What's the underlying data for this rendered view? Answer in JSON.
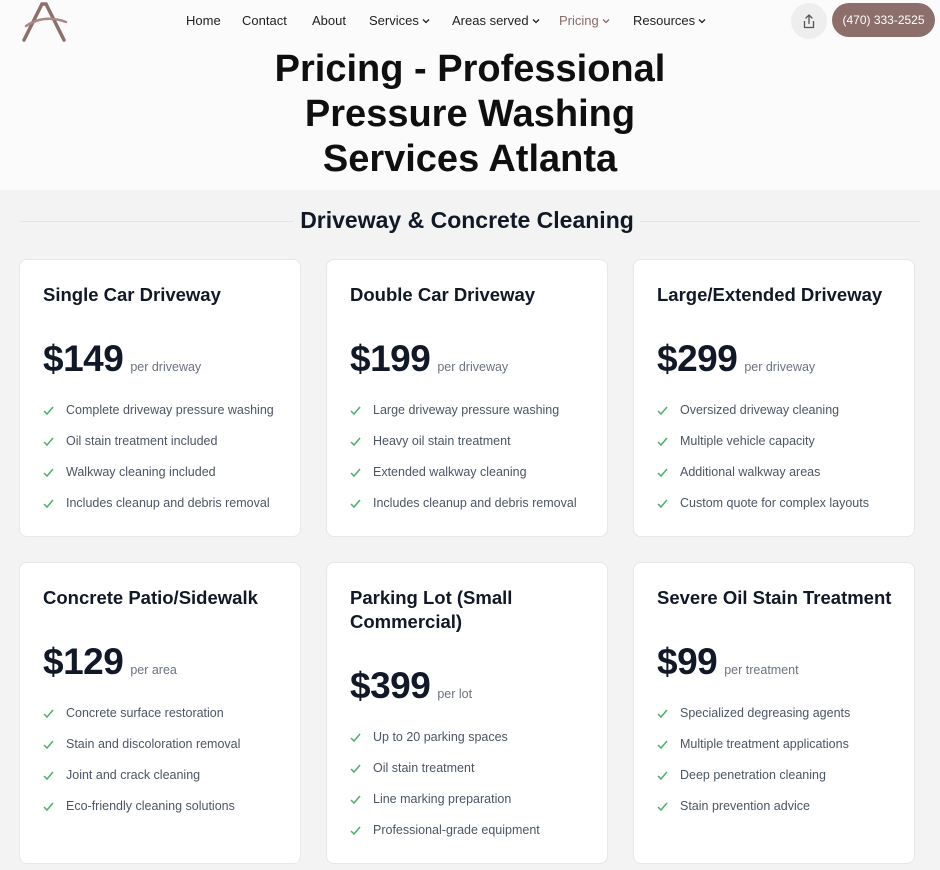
{
  "nav": {
    "items": [
      "Home",
      "Contact",
      "About",
      "Services",
      "Areas served",
      "Pricing",
      "Resources"
    ],
    "active": "Pricing",
    "dropdown_items": [
      "Services",
      "Areas served",
      "Pricing",
      "Resources"
    ],
    "phone": "(470) 333-2525",
    "brand_color": "#8c6e6a"
  },
  "hero": {
    "title_lines": [
      "Pricing - Professional",
      "Pressure Washing",
      "Services Atlanta"
    ]
  },
  "section": {
    "title": "Driveway & Concrete Cleaning"
  },
  "cards": [
    {
      "title": "Single Car Driveway",
      "price": "$149",
      "unit": "per driveway",
      "features": [
        "Complete driveway pressure washing",
        "Oil stain treatment included",
        "Walkway cleaning included",
        "Includes cleanup and debris removal"
      ]
    },
    {
      "title": "Double Car Driveway",
      "price": "$199",
      "unit": "per driveway",
      "features": [
        "Large driveway pressure washing",
        "Heavy oil stain treatment",
        "Extended walkway cleaning",
        "Includes cleanup and debris removal"
      ]
    },
    {
      "title": "Large/Extended Driveway",
      "price": "$299",
      "unit": "per driveway",
      "features": [
        "Oversized driveway cleaning",
        "Multiple vehicle capacity",
        "Additional walkway areas",
        "Custom quote for complex layouts"
      ]
    },
    {
      "title": "Concrete Patio/Sidewalk",
      "price": "$129",
      "unit": "per area",
      "features": [
        "Concrete surface restoration",
        "Stain and discoloration removal",
        "Joint and crack cleaning",
        "Eco-friendly cleaning solutions"
      ]
    },
    {
      "title": "Parking Lot (Small Commercial)",
      "price": "$399",
      "unit": "per lot",
      "features": [
        "Up to 20 parking spaces",
        "Oil stain treatment",
        "Line marking preparation",
        "Professional-grade equipment"
      ]
    },
    {
      "title": "Severe Oil Stain Treatment",
      "price": "$99",
      "unit": "per treatment",
      "features": [
        "Specialized degreasing agents",
        "Multiple treatment applications",
        "Deep penetration cleaning",
        "Stain prevention advice"
      ]
    }
  ],
  "icons": {
    "logo": "letter-a-logo",
    "share": "share-icon",
    "chevron": "chevron-down-icon",
    "check": "check-icon",
    "check_color": "#4caf6a"
  }
}
